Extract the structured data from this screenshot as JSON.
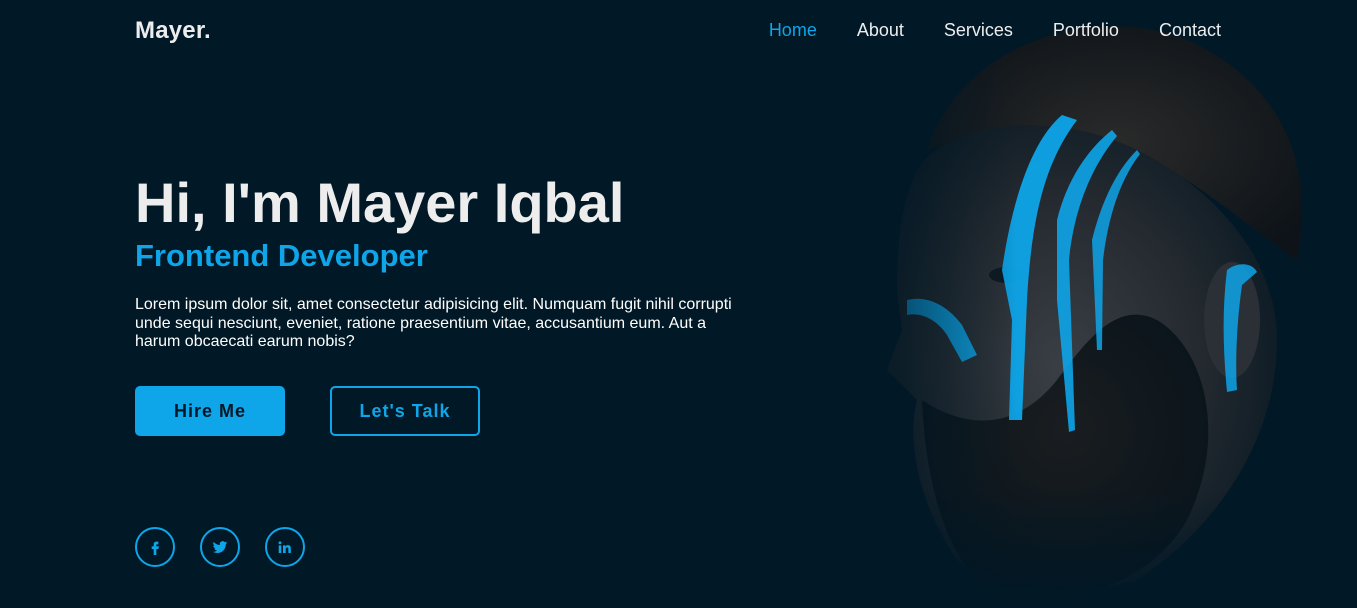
{
  "header": {
    "logo": "Mayer.",
    "nav": [
      {
        "label": "Home",
        "active": true
      },
      {
        "label": "About",
        "active": false
      },
      {
        "label": "Services",
        "active": false
      },
      {
        "label": "Portfolio",
        "active": false
      },
      {
        "label": "Contact",
        "active": false
      }
    ]
  },
  "hero": {
    "title": "Hi, I'm Mayer Iqbal",
    "subtitle": "Frontend Developer",
    "description": "Lorem ipsum dolor sit, amet consectetur adipisicing elit. Numquam fugit nihil corrupti unde sequi nesciunt, eveniet, ratione praesentium vitae, accusantium eum. Aut a harum obcaecati earum nobis?",
    "primary_button": "Hire Me",
    "secondary_button": "Let's Talk"
  },
  "socials": [
    {
      "name": "facebook-icon"
    },
    {
      "name": "twitter-icon"
    },
    {
      "name": "linkedin-icon"
    }
  ],
  "colors": {
    "background": "#011826",
    "accent": "#0ea5e9",
    "text": "#ededed"
  }
}
